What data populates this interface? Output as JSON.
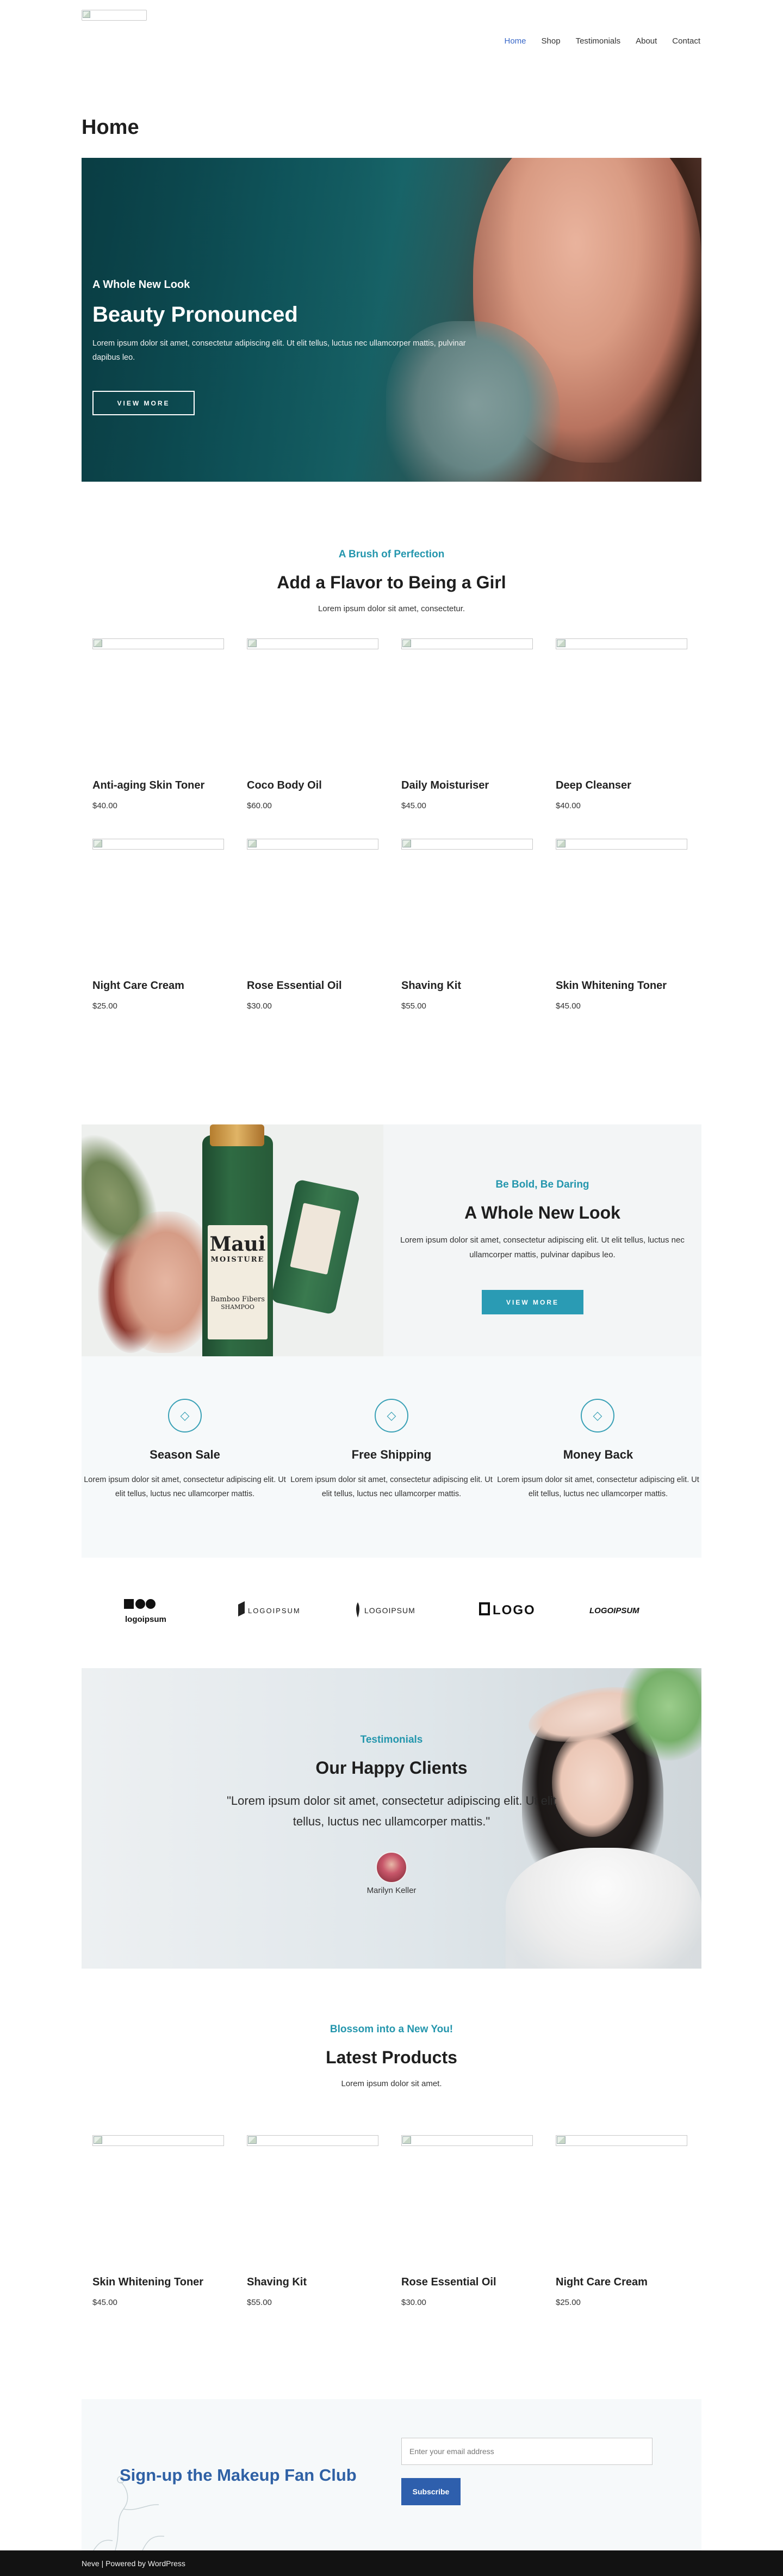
{
  "header": {
    "logo_alt": "",
    "nav": [
      {
        "label": "Home",
        "active": true
      },
      {
        "label": "Shop",
        "active": false
      },
      {
        "label": "Testimonials",
        "active": false
      },
      {
        "label": "About",
        "active": false
      },
      {
        "label": "Contact",
        "active": false
      }
    ]
  },
  "page_title": "Home",
  "hero": {
    "kicker": "A Whole New Look",
    "title": "Beauty Pronounced",
    "text": "Lorem ipsum dolor sit amet, consectetur adipiscing elit. Ut elit tellus, luctus nec ullamcorper mattis, pulvinar dapibus leo.",
    "button": "VIEW MORE"
  },
  "products_section": {
    "kicker": "A Brush of Perfection",
    "title": "Add a Flavor to Being a Girl",
    "subtitle": "Lorem ipsum dolor sit amet, consectetur.",
    "items": [
      {
        "name": "Anti-aging Skin Toner",
        "price": "$40.00"
      },
      {
        "name": "Coco Body Oil",
        "price": "$60.00"
      },
      {
        "name": "Daily Moisturiser",
        "price": "$45.00"
      },
      {
        "name": "Deep Cleanser",
        "price": "$40.00"
      },
      {
        "name": "Night Care Cream",
        "price": "$25.00"
      },
      {
        "name": "Rose Essential Oil",
        "price": "$30.00"
      },
      {
        "name": "Shaving Kit",
        "price": "$55.00"
      },
      {
        "name": "Skin Whitening Toner",
        "price": "$45.00"
      }
    ]
  },
  "feature": {
    "bottle_brand": "Maui",
    "bottle_sub": "MOISTURE",
    "bottle_line": "Bamboo Fibers",
    "bottle_type": "SHAMPOO",
    "kicker": "Be Bold, Be Daring",
    "title": "A Whole New Look",
    "text": "Lorem ipsum dolor sit amet, consectetur adipiscing elit. Ut elit tellus, luctus nec ullamcorper mattis, pulvinar dapibus leo.",
    "button": "VIEW MORE"
  },
  "services": [
    {
      "icon": "tag-icon",
      "title": "Season Sale",
      "text": "Lorem ipsum dolor sit amet, consectetur adipiscing elit. Ut elit tellus, luctus nec ullamcorper mattis."
    },
    {
      "icon": "truck-icon",
      "title": "Free Shipping",
      "text": "Lorem ipsum dolor sit amet, consectetur adipiscing elit. Ut elit tellus, luctus nec ullamcorper mattis."
    },
    {
      "icon": "money-icon",
      "title": "Money Back",
      "text": "Lorem ipsum dolor sit amet, consectetur adipiscing elit. Ut elit tellus, luctus nec ullamcorper mattis."
    }
  ],
  "logos": [
    "logoipsum",
    "LOGOIPSUM",
    "LOGOIPSUM",
    "LOGO",
    "LOGOIPSUM"
  ],
  "testimonials": {
    "kicker": "Testimonials",
    "title": "Our Happy Clients",
    "quote": "\"Lorem ipsum dolor sit amet, consectetur adipiscing elit. Ut elit tellus, luctus nec ullamcorper mattis.\"",
    "name": "Marilyn Keller"
  },
  "latest": {
    "kicker": "Blossom into a New You!",
    "title": "Latest Products",
    "subtitle": "Lorem ipsum dolor sit amet.",
    "items": [
      {
        "name": "Skin Whitening Toner",
        "price": "$45.00"
      },
      {
        "name": "Shaving Kit",
        "price": "$55.00"
      },
      {
        "name": "Rose Essential Oil",
        "price": "$30.00"
      },
      {
        "name": "Night Care Cream",
        "price": "$25.00"
      }
    ]
  },
  "newsletter": {
    "title": "Sign-up the Makeup Fan Club",
    "placeholder": "Enter your email address",
    "button": "Subscribe"
  },
  "footer": {
    "text": "Neve | Powered by WordPress"
  },
  "colors": {
    "accent": "#2496ad",
    "nav_active": "#3867c8",
    "newsletter_title": "#2f61a5",
    "button_primary": "#2e5fad",
    "footer_bg": "#121212"
  }
}
